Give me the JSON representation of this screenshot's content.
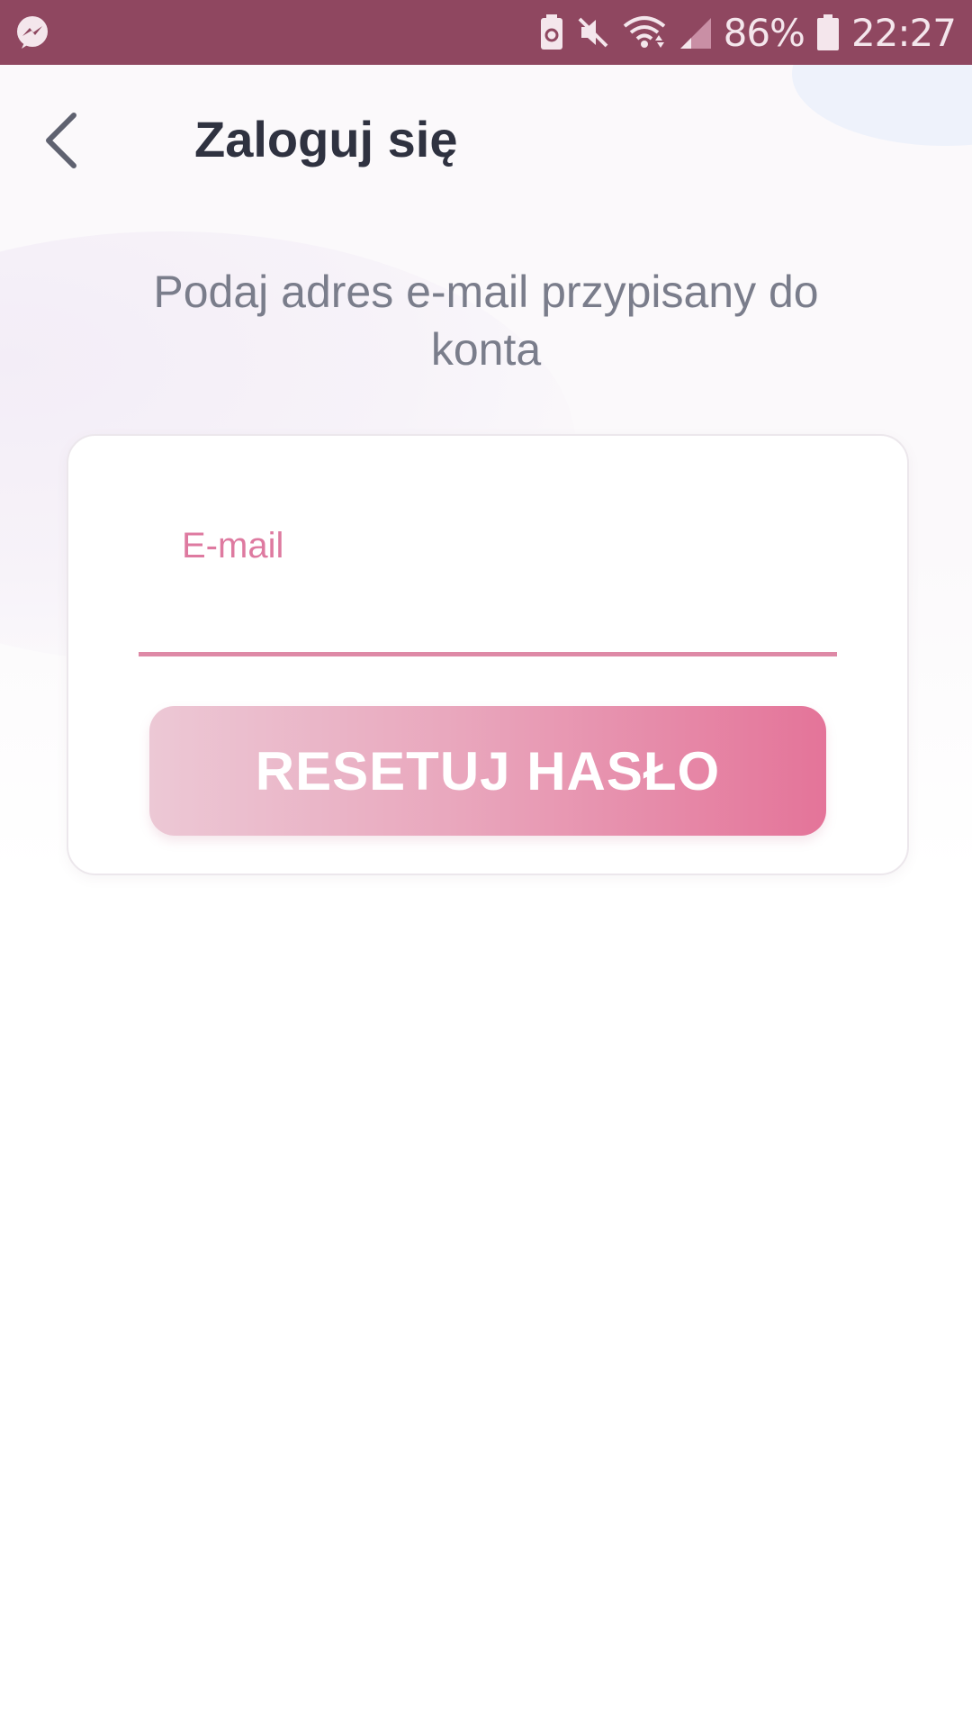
{
  "status_bar": {
    "battery_percent": "86%",
    "time": "22:27",
    "icons": [
      "messenger-icon",
      "battery-saver-icon",
      "mute-icon",
      "wifi-icon",
      "signal-icon",
      "battery-icon"
    ]
  },
  "header": {
    "back_icon": "chevron-left-icon",
    "title": "Zaloguj się"
  },
  "subtitle": "Podaj adres e-mail przypisany do konta",
  "form": {
    "email_label": "E-mail",
    "email_value": "",
    "reset_button": "RESETUJ HASŁO"
  },
  "colors": {
    "status_bar": "#8f4760",
    "accent": "#de7aa0",
    "button_gradient_start": "#ecc8d5",
    "button_gradient_end": "#e47499",
    "title_text": "#2f3240",
    "subtitle_text": "#7a7d8b"
  }
}
